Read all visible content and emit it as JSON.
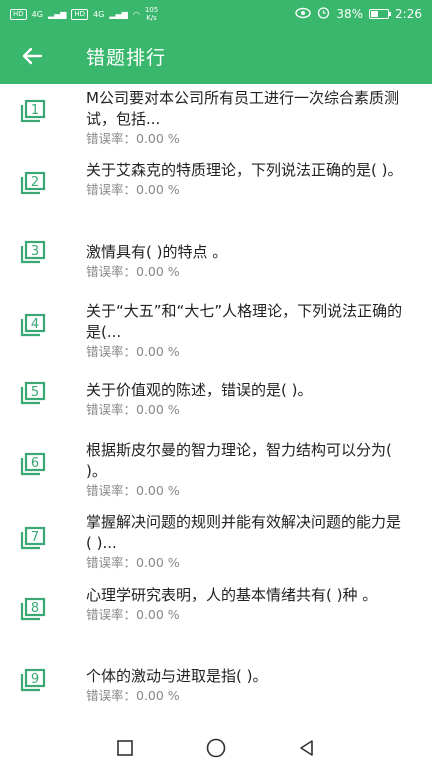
{
  "status_bar": {
    "sim1": "HD",
    "sim2": "HD",
    "net1": "4G",
    "net2": "4G",
    "speed_value": "105",
    "speed_unit": "K/s",
    "battery": "38%",
    "time": "2:26"
  },
  "appbar": {
    "title": "错题排行",
    "back_icon": "arrow-left-icon"
  },
  "colors": {
    "brand": "#38b76d",
    "icon": "#3aa872",
    "rate_text": "#888888"
  },
  "questions": [
    {
      "num": "1",
      "title": "M公司要对本公司所有员工进行一次综合素质测试，包括...",
      "rate": "错误率：0.00 %"
    },
    {
      "num": "2",
      "title": "关于艾森克的特质理论，下列说法正确的是(  )。",
      "rate": "错误率：0.00 %"
    },
    {
      "num": "3",
      "title": "激情具有(  )的特点 。",
      "rate": "错误率：0.00 %"
    },
    {
      "num": "4",
      "title": "关于“大五”和“大七”人格理论，下列说法正确的是(...",
      "rate": "错误率：0.00 %"
    },
    {
      "num": "5",
      "title": "关于价值观的陈述，错误的是(  )。",
      "rate": "错误率：0.00 %"
    },
    {
      "num": "6",
      "title": "根据斯皮尔曼的智力理论，智力结构可以分为(  )。",
      "rate": "错误率：0.00 %"
    },
    {
      "num": "7",
      "title": "掌握解决问题的规则并能有效解决问题的能力是(  )...",
      "rate": "错误率：0.00 %"
    },
    {
      "num": "8",
      "title": "心理学研究表明，人的基本情绪共有(  )种 。",
      "rate": "错误率：0.00 %"
    },
    {
      "num": "9",
      "title": "个体的激动与进取是指(  )。",
      "rate": "错误率：0.00 %"
    }
  ],
  "nav": {
    "recent_icon": "square-icon",
    "home_icon": "circle-icon",
    "back_icon": "triangle-back-icon"
  }
}
